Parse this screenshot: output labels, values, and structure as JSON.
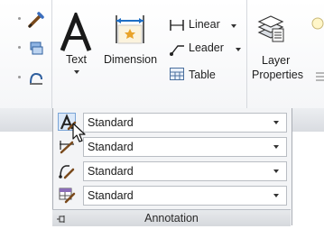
{
  "ribbon": {
    "text_label": "Text",
    "dimension_label": "Dimension",
    "linear_label": "Linear",
    "leader_label": "Leader",
    "table_label": "Table",
    "layer_properties_label_1": "Layer",
    "layer_properties_label_2": "Properties"
  },
  "annotation_panel": {
    "title": "Annotation",
    "rows": [
      {
        "icon": "text-style-icon",
        "value": "Standard"
      },
      {
        "icon": "dimension-style-icon",
        "value": "Standard"
      },
      {
        "icon": "multileader-style-icon",
        "value": "Standard"
      },
      {
        "icon": "table-style-icon",
        "value": "Standard"
      }
    ]
  },
  "colors": {
    "accent_blue": "#1f6fc5",
    "accent_orange": "#e9a32a"
  }
}
